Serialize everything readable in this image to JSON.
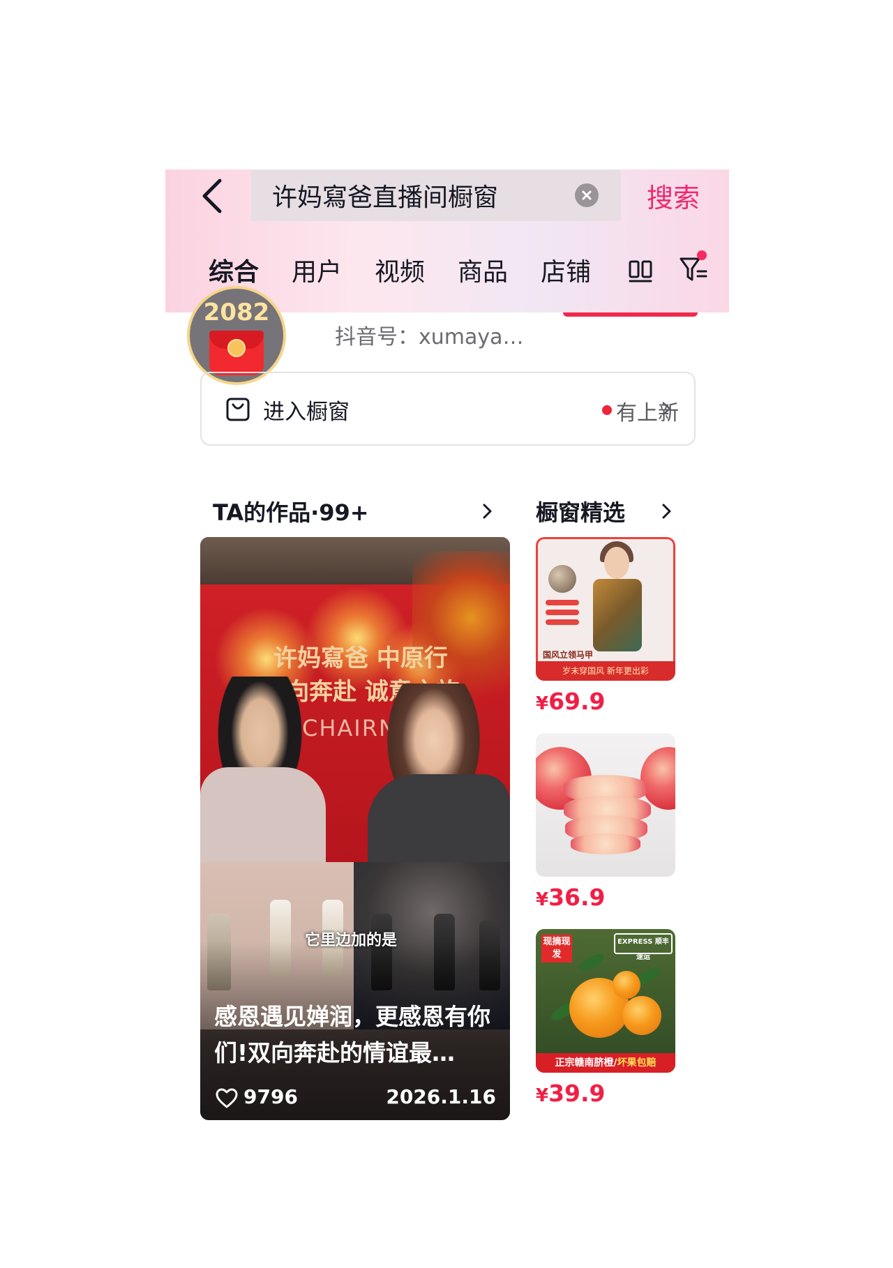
{
  "search": {
    "query": "许妈寫爸直播间橱窗",
    "button_label": "搜索"
  },
  "tabs": [
    {
      "label": "综合",
      "active": true
    },
    {
      "label": "用户",
      "active": false
    },
    {
      "label": "视频",
      "active": false
    },
    {
      "label": "商品",
      "active": false
    },
    {
      "label": "店铺",
      "active": false
    }
  ],
  "icons": {
    "back": "chevron-left-icon",
    "clear": "close-circle-icon",
    "layout": "double-column-icon",
    "filter": "filter-icon",
    "window": "shopping-bag-icon",
    "like": "heart-icon"
  },
  "profile": {
    "avatar_count": "2082",
    "douyin_id": "抖音号：xumaya…"
  },
  "window_entry": {
    "label": "进入橱窗",
    "new_label": "有上新"
  },
  "works": {
    "title": "TA的作品·99+",
    "video": {
      "banner_line1": "许妈寫爸  中原行",
      "banner_line2": "双向奔赴 诚意之旅",
      "brand": "CHAIRN",
      "overlay_text": "它里边加的是",
      "caption": "感恩遇见婵润，更感恩有你们!双向奔赴的情谊最…",
      "likes": "9796",
      "date": "2026.1.16"
    }
  },
  "featured": {
    "title": "橱窗精选",
    "products": [
      {
        "price_symbol": "¥",
        "price": "69.9",
        "image_footer": "岁末穿国风 新年更出彩",
        "image_subtitle": "国风立领马甲"
      },
      {
        "price_symbol": "¥",
        "price": "36.9"
      },
      {
        "price_symbol": "¥",
        "price": "39.9",
        "badge": "现摘现发",
        "express": "EXPRESS 顺丰速运",
        "footer_a": "正宗赣南脐橙/",
        "footer_b": "坏果包赔"
      }
    ]
  },
  "colors": {
    "accent": "#f0286e",
    "price": "#f11f45",
    "new_dot": "#f0233d"
  }
}
